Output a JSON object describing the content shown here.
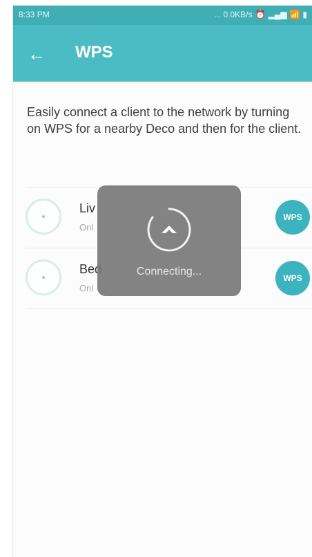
{
  "status_bar": {
    "time": "8:33 PM",
    "speed": "... 0.0KB/s",
    "icons": [
      "alarm-icon",
      "signal-icon",
      "wifi-icon",
      "battery-icon"
    ]
  },
  "header": {
    "back_icon": "arrow-left-icon",
    "title": "WPS"
  },
  "description": "Easily connect a client to the network by turning on WPS for a nearby Deco and then for the client.",
  "devices": [
    {
      "name": "Liv",
      "status": "Onl",
      "button_label": "WPS"
    },
    {
      "name": "Bed",
      "status": "Onl",
      "button_label": "WPS"
    }
  ],
  "loading_dialog": {
    "text": "Connecting..."
  },
  "colors": {
    "accent": "#4bbcc3",
    "status_bar": "#41aeb6",
    "wps_button": "#3bb4bf"
  }
}
